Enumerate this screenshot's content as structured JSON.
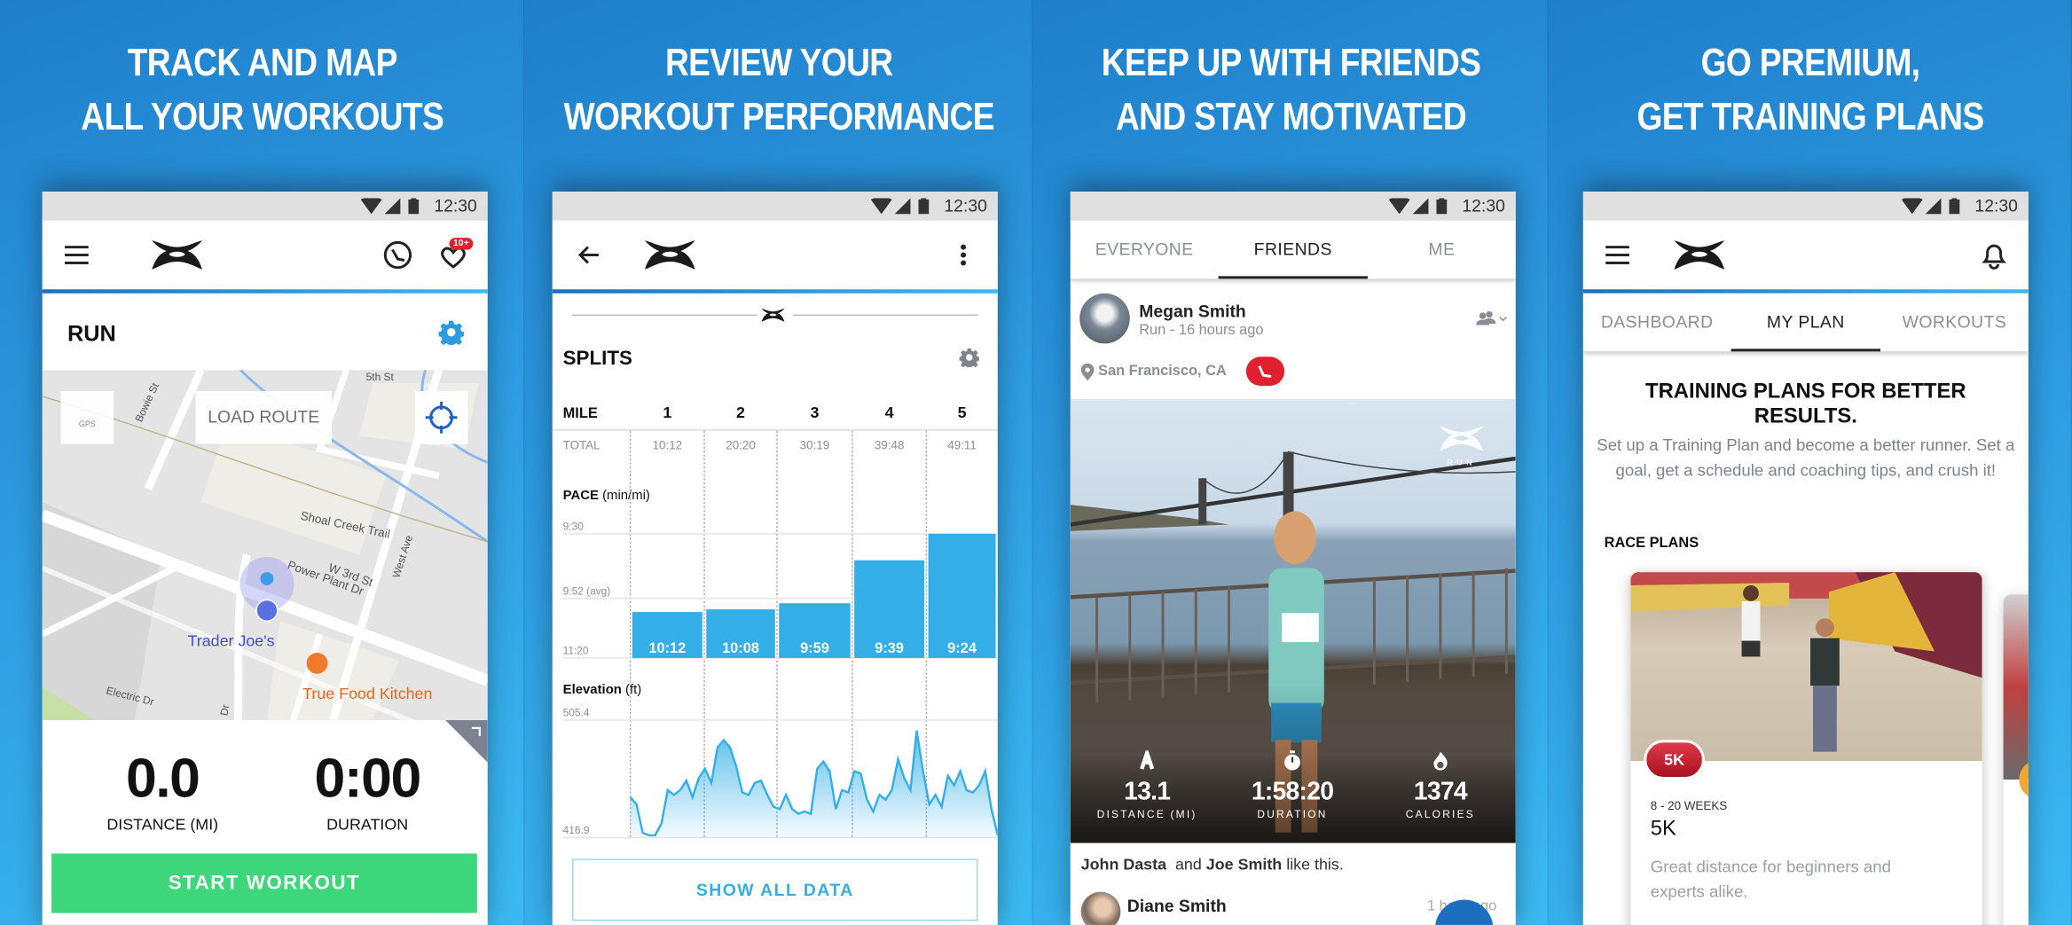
{
  "colors": {
    "accent_blue": "#33aee6",
    "start_green": "#3dd67a",
    "badge_red": "#e0202e",
    "background_blue": "#2a8fd6"
  },
  "status_bar": {
    "time": "12:30",
    "icons": [
      "wifi-icon",
      "signal-icon",
      "battery-icon"
    ]
  },
  "panels": [
    {
      "headline": [
        "TRACK AND MAP",
        "ALL YOUR WORKOUTS"
      ],
      "appbar": {
        "icons": [
          "menu-icon",
          "under-armour-logo",
          "shoe-icon",
          "heart-notification-icon"
        ],
        "badge": "10+"
      },
      "activity": {
        "title": "RUN"
      },
      "map": {
        "gps_label": "GPS",
        "load_route": "LOAD ROUTE",
        "labels": {
          "bowie": "Bowie St",
          "fifth": "5th St",
          "shoal": "Shoal Creek Trail",
          "west": "West Ave",
          "third": "W 3rd St",
          "power": "Power Plant Dr",
          "electric": "Electric Dr",
          "dr": "Dr",
          "trader": "Trader Joe's",
          "truefood": "True Food Kitchen"
        }
      },
      "stats": [
        {
          "value": "0.0",
          "label": "DISTANCE (MI)"
        },
        {
          "value": "0:00",
          "label": "DURATION"
        }
      ],
      "start_button": "START WORKOUT"
    },
    {
      "headline": [
        "REVIEW YOUR",
        "WORKOUT PERFORMANCE"
      ],
      "splits": {
        "title": "SPLITS",
        "mile_label": "MILE",
        "total_label": "TOTAL",
        "miles": [
          "1",
          "2",
          "3",
          "4",
          "5"
        ],
        "totals": [
          "10:12",
          "20:20",
          "30:19",
          "39:48",
          "49:11"
        ]
      },
      "show_all": "SHOW ALL DATA"
    },
    {
      "headline": [
        "KEEP UP WITH FRIENDS",
        "AND STAY MOTIVATED"
      ],
      "tabs": [
        "EVERYONE",
        "FRIENDS",
        "ME"
      ],
      "active_tab": "FRIENDS",
      "post": {
        "user": "Megan Smith",
        "meta": "Run - 16 hours ago",
        "location": "San Francisco, CA",
        "watermark": "RUN",
        "stats": [
          {
            "icon": "route-icon",
            "value": "13.1",
            "label": "DISTANCE (MI)"
          },
          {
            "icon": "stopwatch-icon",
            "value": "1:58:20",
            "label": "DURATION"
          },
          {
            "icon": "flame-icon",
            "value": "1374",
            "label": "CALORIES"
          }
        ],
        "likes": {
          "name1": "John Dasta",
          "and": "and",
          "name2": "Joe Smith",
          "suffix": "like this."
        }
      },
      "next_post": {
        "user": "Diane Smith",
        "time": "1 hour ago"
      }
    },
    {
      "headline": [
        "GO PREMIUM,",
        "GET TRAINING PLANS"
      ],
      "tabs": [
        "DASHBOARD",
        "MY PLAN",
        "WORKOUTS"
      ],
      "active_tab": "MY PLAN",
      "intro": {
        "title": "TRAINING PLANS FOR BETTER RESULTS.",
        "body": "Set up a Training Plan and become a better runner. Set a goal, get a schedule and coaching tips, and crush it!"
      },
      "section": "RACE PLANS",
      "card": {
        "badge": "5K",
        "duration": "8 - 20 WEEKS",
        "name": "5K",
        "description": "Great distance for beginners and experts alike."
      }
    }
  ],
  "chart_data": [
    {
      "type": "bar",
      "title": "PACE",
      "unit": "(min/mi)",
      "categories": [
        "1",
        "2",
        "3",
        "4",
        "5"
      ],
      "values": [
        "10:12",
        "10:08",
        "9:59",
        "9:39",
        "9:24"
      ],
      "ticks": [
        "9:30",
        "9:52 (avg)",
        "11:20"
      ],
      "ylim": [
        "11:20",
        "9:30"
      ],
      "average": "9:52",
      "grid": true
    },
    {
      "type": "area",
      "title": "Elevation",
      "unit": "(ft)",
      "xlabel": "MILE",
      "xlim": [
        0,
        5
      ],
      "ylim": [
        416.9,
        505.4
      ],
      "ticks": [
        "505.4",
        "416.9"
      ],
      "grid": true,
      "values": [
        447.3,
        442.0,
        420.5,
        418.7,
        418.7,
        427.6,
        452.7,
        449.1,
        452.7,
        459.9,
        447.3,
        461.7,
        468.8,
        458.1,
        484.9,
        490.3,
        484.9,
        470.6,
        450.9,
        449.1,
        458.1,
        459.9,
        449.1,
        440.2,
        438.4,
        449.1,
        438.4,
        434.8,
        436.6,
        434.8,
        468.8,
        474.2,
        467.0,
        438.4,
        452.7,
        450.9,
        467.0,
        465.2,
        445.5,
        436.6,
        449.1,
        445.5,
        452.7,
        476.0,
        461.7,
        452.7,
        497.5,
        467.0,
        442.0,
        449.1,
        440.2,
        463.4,
        456.3,
        467.0,
        452.7,
        450.9,
        456.3,
        467.0,
        438.4,
        418.7
      ]
    }
  ]
}
